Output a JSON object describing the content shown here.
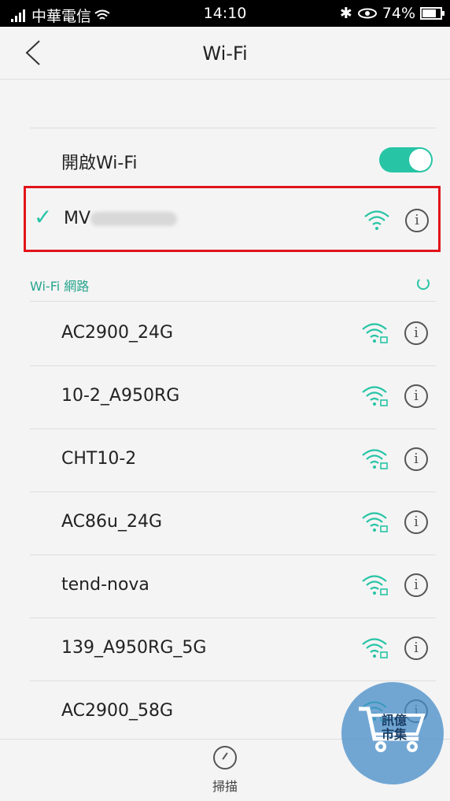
{
  "status_bar": {
    "carrier": "中華電信",
    "time": "14:10",
    "battery": "74%"
  },
  "app_bar": {
    "title": "Wi-Fi"
  },
  "wifi_toggle": {
    "label": "開啟Wi-Fi",
    "state": "on"
  },
  "connected_network": {
    "name": "MV"
  },
  "networks_section": {
    "title": "Wi-Fi 網路",
    "networks": [
      {
        "name": "AC2900_24G"
      },
      {
        "name": "10-2_A950RG"
      },
      {
        "name": "CHT10-2"
      },
      {
        "name": "AC86u_24G"
      },
      {
        "name": "tend-nova"
      },
      {
        "name": "139_A950RG_5G"
      },
      {
        "name": "AC2900_58G"
      }
    ]
  },
  "bottom_bar": {
    "scan_label": "掃描"
  },
  "watermark": {
    "line1": "訊億",
    "line2": "市集"
  },
  "colors": {
    "accent": "#27c4a5",
    "highlight_border": "#e1141a"
  }
}
